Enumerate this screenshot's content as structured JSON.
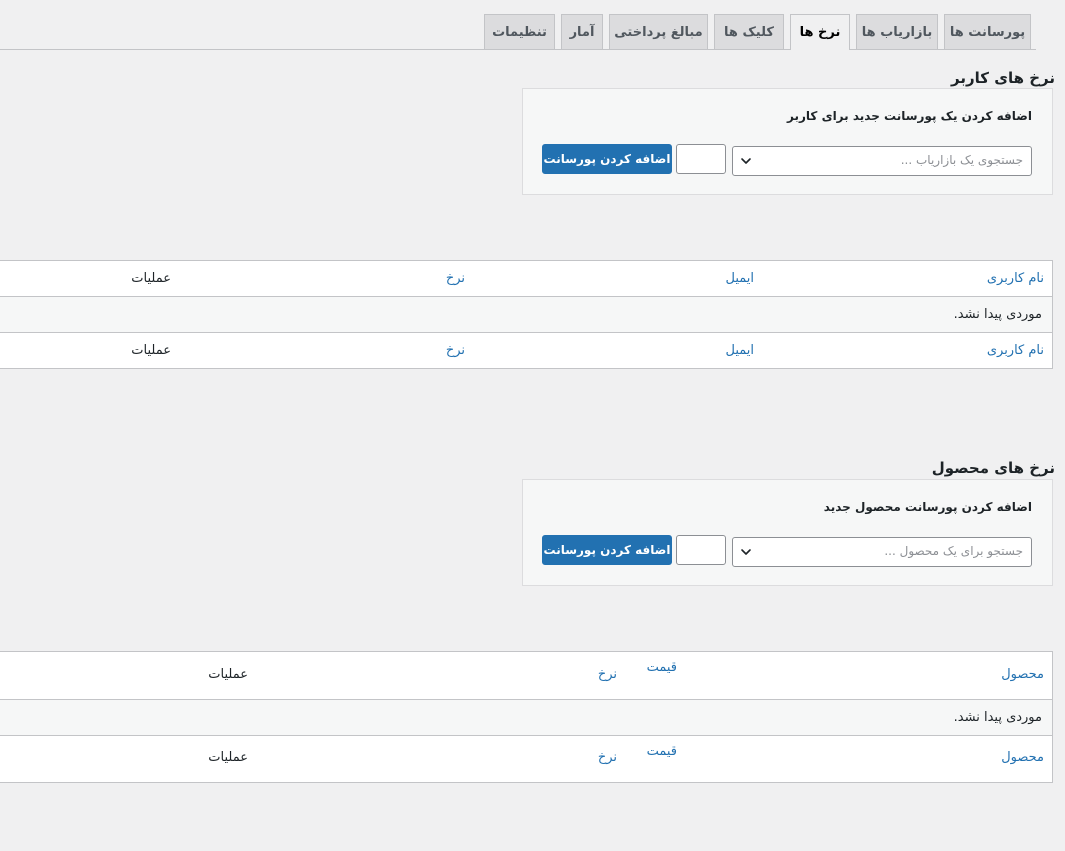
{
  "tabs": [
    {
      "label": "پورسانت ها"
    },
    {
      "label": "بازاریاب ها"
    },
    {
      "label": "نرخ ها"
    },
    {
      "label": "کلیک ها"
    },
    {
      "label": "مبالغ پرداختی"
    },
    {
      "label": "آمار"
    },
    {
      "label": "تنظیمات"
    }
  ],
  "active_tab": "نرخ ها",
  "user_rates": {
    "title": "نرخ های کاربر",
    "add_box": {
      "title": "اضافه کردن یک پورسانت جدید برای کاربر",
      "search_placeholder": "جستجوی یک بازاریاب ...",
      "rate_value": "",
      "button_label": "اضافه کردن پورسانت"
    },
    "table": {
      "header": {
        "username": "نام کاربری",
        "email": "ایمیل",
        "rate": "نرخ",
        "actions": "عملیات"
      },
      "empty_message": "موردی پیدا نشد.",
      "footer": {
        "username": "نام کاربری",
        "email": "ایمیل",
        "rate": "نرخ",
        "actions": "عملیات"
      }
    }
  },
  "product_rates": {
    "title": "نرخ های محصول",
    "add_box": {
      "title": "اضافه کردن پورسانت محصول جدید",
      "search_placeholder": "جستجو برای یک محصول ...",
      "rate_value": "",
      "button_label": "اضافه کردن پورسانت"
    },
    "table": {
      "header": {
        "product": "محصول",
        "price": "قیمت",
        "rate": "نرخ",
        "actions": "عملیات"
      },
      "empty_message": "موردی پیدا نشد.",
      "footer": {
        "product": "محصول",
        "price": "قیمت",
        "rate": "نرخ",
        "actions": "عملیات"
      }
    }
  },
  "colors": {
    "accent": "#2271b1",
    "background": "#f0f0f1",
    "tab_inactive": "#dcdcde",
    "border": "#c3c4c7"
  },
  "icons": {
    "select_arrow": "chevron-down-icon"
  }
}
